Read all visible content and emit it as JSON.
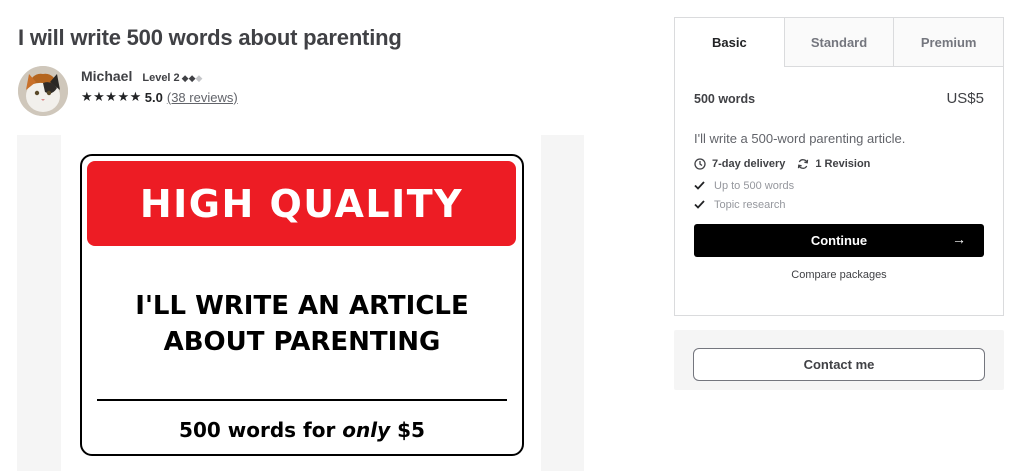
{
  "gig": {
    "title": "I will write 500 words about parenting"
  },
  "seller": {
    "name": "Michael",
    "level": "Level 2",
    "rating_stars": "★★★★★",
    "rating": "5.0",
    "reviews_link": "(38 reviews)"
  },
  "gallery": {
    "banner": "HIGH QUALITY",
    "headline_line1": "I'LL WRITE AN ARTICLE",
    "headline_line2": "ABOUT PARENTING",
    "price_prefix": "500 words for ",
    "price_emph": "only",
    "price_suffix": " $5",
    "colors": {
      "banner": "#ed1c24"
    }
  },
  "packages": {
    "tabs": [
      {
        "label": "Basic",
        "active": true
      },
      {
        "label": "Standard",
        "active": false
      },
      {
        "label": "Premium",
        "active": false
      }
    ],
    "selected": {
      "name": "500 words",
      "price": "US$5",
      "description": "I'll write a 500-word parenting article.",
      "delivery": "7-day delivery",
      "revisions": "1 Revision",
      "features": [
        "Up to 500 words",
        "Topic research"
      ]
    },
    "continue_label": "Continue",
    "continue_icon": "arrow-right-icon",
    "compare_label": "Compare packages"
  },
  "contact": {
    "button_label": "Contact me"
  }
}
